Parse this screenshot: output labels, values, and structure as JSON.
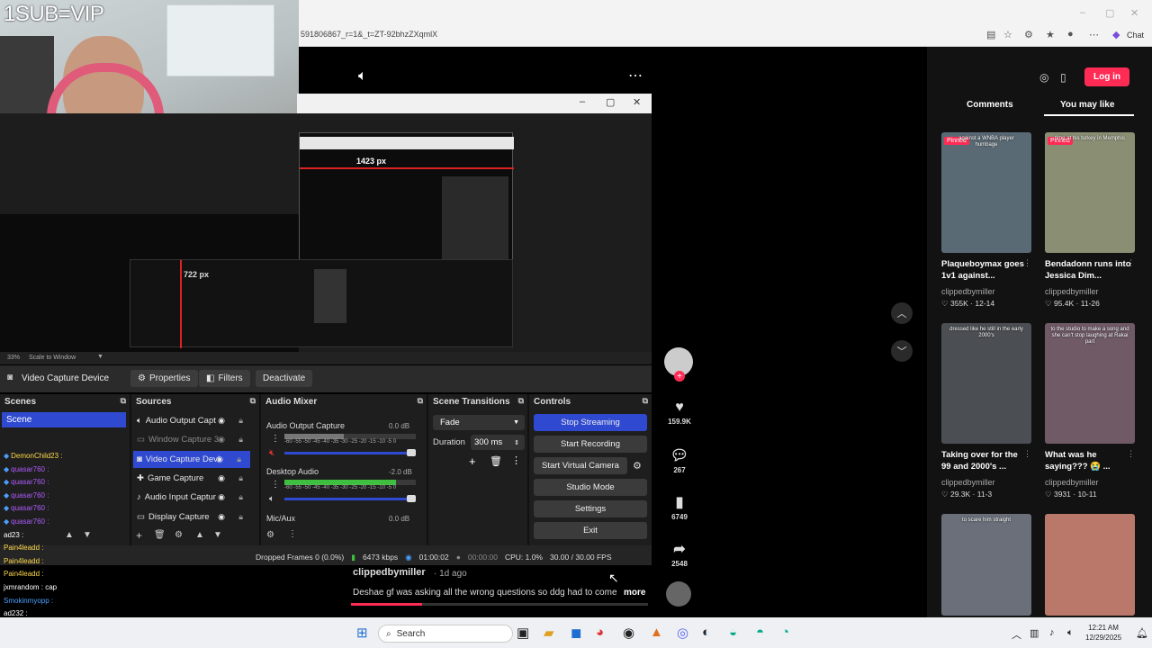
{
  "overlay": {
    "sub_vip": "1SUB=VIP"
  },
  "browser": {
    "url_text": "591806867_r=1&_t=ZT-92bhzZXqmlX",
    "chat_label": "Chat"
  },
  "obs": {
    "preview": {
      "px_label": "1423 px",
      "px_label_small": "722 px"
    },
    "zoom": "33%",
    "scale_mode": "Scale to Window",
    "source_name": "Video Capture Device",
    "buttons": {
      "properties": "Properties",
      "filters": "Filters",
      "deactivate": "Deactivate"
    },
    "docks": {
      "scenes": "Scenes",
      "sources": "Sources",
      "audio_mixer": "Audio Mixer",
      "scene_transitions": "Scene Transitions",
      "controls": "Controls"
    },
    "scene_selected": "Scene",
    "sources": [
      {
        "label": "Audio Output Capt",
        "icon": "speaker-icon"
      },
      {
        "label": "Window Capture 3",
        "icon": "window-icon"
      },
      {
        "label": "Video Capture Devi",
        "icon": "camera-icon"
      },
      {
        "label": "Game Capture",
        "icon": "gamepad-icon"
      },
      {
        "label": "Audio Input Captur",
        "icon": "microphone-icon"
      },
      {
        "label": "Display Capture",
        "icon": "monitor-icon"
      }
    ],
    "mixer": [
      {
        "label": "Audio Output Capture",
        "db": "0.0 dB",
        "level": 0.45,
        "color": "#777777"
      },
      {
        "label": "Desktop Audio",
        "db": "-2.0 dB",
        "level": 0.85,
        "color": "#3fbf3f"
      },
      {
        "label": "Mic/Aux",
        "db": "0.0 dB",
        "level": 0,
        "color": "#777777"
      }
    ],
    "meter_scale": "-60 -55 -50 -45 -40 -35 -30 -25 -20 -15 -10 -5 0",
    "transition": {
      "type": "Fade",
      "duration_label": "Duration",
      "duration": "300 ms"
    },
    "controls": [
      "Stop Streaming",
      "Start Recording",
      "Start Virtual Camera",
      "Studio Mode",
      "Settings",
      "Exit"
    ],
    "status": {
      "dropped": "Dropped Frames 0 (0.0%)",
      "bitrate": "6473 kbps",
      "live_time": "01:00:02",
      "rec_time": "00:00:00",
      "cpu": "CPU: 1.0%",
      "fps": "30.00 / 30.00 FPS"
    }
  },
  "chat": [
    {
      "user": "DemonChild23 :",
      "color": "#ffd84a"
    },
    {
      "user": "quasar760 :",
      "color": "#b05cff"
    },
    {
      "user": "quasar760 :",
      "color": "#b05cff"
    },
    {
      "user": "quasar760 :",
      "color": "#b05cff"
    },
    {
      "user": "quasar760 :",
      "color": "#b05cff"
    },
    {
      "user": "quasar760 :",
      "color": "#b05cff"
    },
    {
      "user": "ad23 :",
      "color": "#ffffff"
    },
    {
      "user": "Pain4leadd :",
      "color": "#ffd84a"
    },
    {
      "user": "Pain4leadd :",
      "color": "#ffd84a"
    },
    {
      "user": "Pain4leadd :",
      "color": "#ffd84a"
    },
    {
      "user": "jxmrandom : cap",
      "color": "#ffffff"
    },
    {
      "user": "Smokinmyopp :",
      "color": "#4aa0ff"
    },
    {
      "user": "ad232 :",
      "color": "#ffffff"
    }
  ],
  "video": {
    "author": "clippedbymiller",
    "date": "· 1d ago",
    "caption": "Deshae gf was asking all the wrong questions so ddg had to come",
    "more": "more",
    "progress": 0.24,
    "likes": "159.9K",
    "comments": "267",
    "saves": "6749",
    "shares": "2548"
  },
  "sidebar": {
    "login": "Log in",
    "tabs": {
      "comments": "Comments",
      "you_may_like": "You may like"
    },
    "pinned": "Pinned",
    "cards": [
      {
        "title": "Plaqueboymax goes 1v1 against...",
        "user": "clippedbymiller",
        "stats": "♡ 355K · 12-14",
        "overlay": "against a WNBA player humbage",
        "color": "#5a6a74",
        "pinned": true
      },
      {
        "title": "Bendadonn runs into Jessica Dim...",
        "user": "clippedbymiller",
        "stats": "♡ 95.4K · 11-26",
        "overlay": "time at his turkey in Memphis",
        "color": "#8a8f74",
        "pinned": true
      },
      {
        "title": "Taking over for the 99 and 2000's ...",
        "user": "clippedbymiller",
        "stats": "♡ 29.3K · 11-3",
        "overlay": "dressed like he still in the early 2000's",
        "color": "#4b4e52",
        "pinned": false
      },
      {
        "title": "What was he saying??? 😭 ...",
        "user": "clippedbymiller",
        "stats": "♡ 3931 · 10-11",
        "overlay": "to the studio to make a song and she can't stop laughing at Rakai part",
        "color": "#6f5a66",
        "pinned": false
      },
      {
        "title": "",
        "user": "",
        "stats": "",
        "overlay": "to scare him straight",
        "color": "#6a6f7a",
        "pinned": false
      },
      {
        "title": "",
        "user": "",
        "stats": "",
        "overlay": "",
        "color": "#b9786a",
        "pinned": false
      }
    ]
  },
  "taskbar": {
    "search": "Search",
    "time": "12:21 AM",
    "date": "12/29/2025"
  }
}
